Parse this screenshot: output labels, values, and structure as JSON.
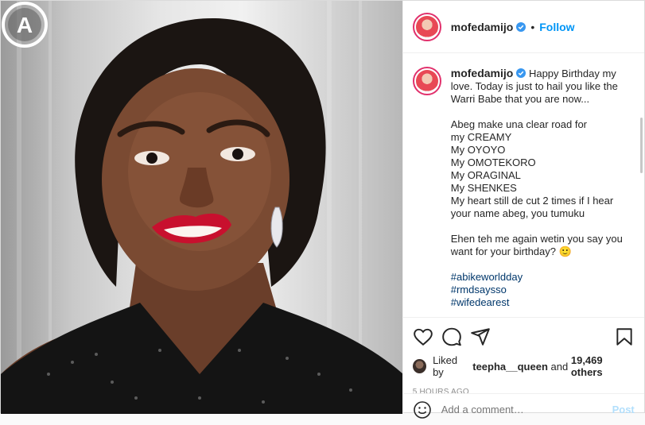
{
  "post": {
    "username": "mofedamijo",
    "follow_label": "Follow",
    "dot": "•",
    "caption": {
      "lines_1": [
        "Happy Birthday my",
        "love. Today is just to hail you like the",
        "Warri Babe that you are now..."
      ],
      "lines_2": [
        "Abeg make una clear road for",
        "my CREAMY",
        "My OYOYO",
        "My OMOTEKORO",
        "My ORAGINAL",
        "My SHENKES",
        "My heart still de cut 2 times if I hear",
        "your name abeg, you tumuku"
      ],
      "lines_3": [
        "Ehen teh me again wetin you say you",
        "want for your birthday? 🙂"
      ],
      "hashtags": [
        "#abikeworldday",
        "#rmdsaysso",
        "#wifedearest"
      ]
    },
    "likes": {
      "prefix": "Liked by",
      "user": "teepha__queen",
      "middle": "and",
      "count": "19,469 others"
    },
    "timestamp": "5 HOURS AGO",
    "comment": {
      "placeholder": "Add a comment…",
      "post_label": "Post"
    },
    "watermark_letter": "A"
  },
  "colors": {
    "accent": "#0095f6",
    "verified": "#3897f0",
    "hashtag": "#00376b",
    "lips": "#c8102e"
  },
  "icons": [
    "verified-icon",
    "heart-icon",
    "comment-icon",
    "share-icon",
    "bookmark-icon",
    "emoji-icon"
  ]
}
